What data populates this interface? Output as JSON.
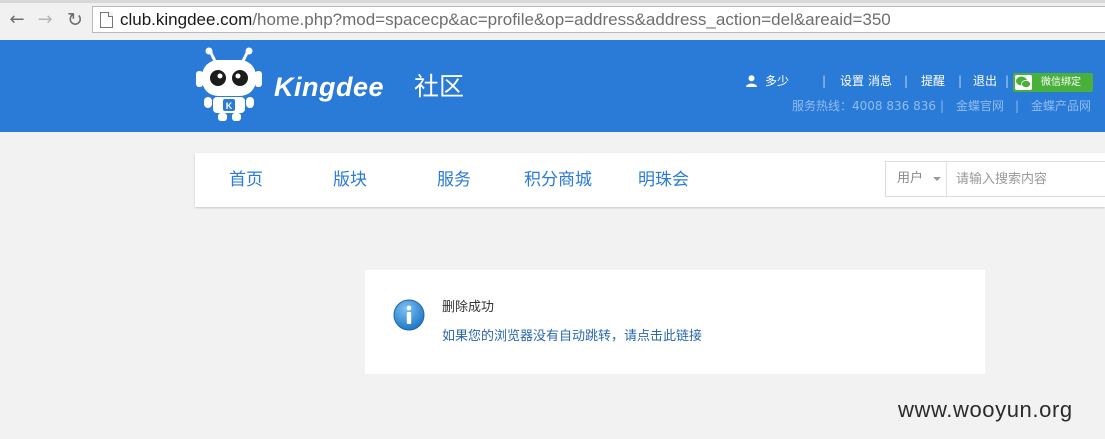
{
  "browser": {
    "url_host": "club.kingdee.com",
    "url_path": "/home.php?mod=spacecp&ac=profile&op=address&address_action=del&areaid=350"
  },
  "header": {
    "logo_text": "Kingdee",
    "logo_suffix": "社区",
    "username": "多少",
    "links": {
      "settings": "设置",
      "messages": "消息",
      "reminders": "提醒",
      "logout": "退出",
      "wechat_bind": "微信绑定"
    },
    "separator": "|",
    "info": {
      "hotline": "服务热线：4008 836 836",
      "official_site": "金蝶官网",
      "product_site": "金蝶产品网"
    },
    "brand_color": "#2a7ad8"
  },
  "nav": {
    "items": [
      "首页",
      "版块",
      "服务",
      "积分商城",
      "明珠会"
    ],
    "search": {
      "type_label": "用户",
      "placeholder": "请输入搜索内容"
    }
  },
  "message": {
    "title": "删除成功",
    "redirect_link": "如果您的浏览器没有自动跳转，请点击此链接",
    "icon": "info-icon"
  },
  "watermark": "www.wooyun.org"
}
